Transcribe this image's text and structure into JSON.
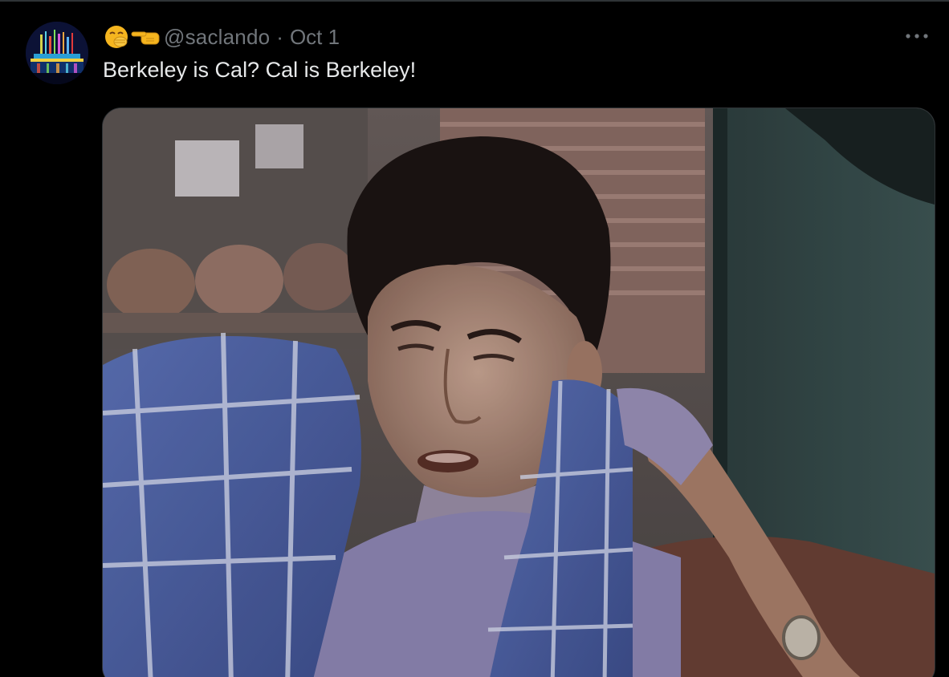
{
  "tweet": {
    "handle": "@saclando",
    "separator": "·",
    "date": "Oct 1",
    "text": "Berkeley is Cal? Cal is Berkeley!",
    "more_label": "···"
  },
  "icons": {
    "emoji_1": "face-with-hand-over-mouth-icon",
    "emoji_2": "backhand-index-pointing-left-icon",
    "more": "more-horizontal-icon"
  },
  "colors": {
    "background": "#000000",
    "primary_text": "#e7e9ea",
    "secondary_text": "#71767b",
    "border": "#2f3336"
  }
}
